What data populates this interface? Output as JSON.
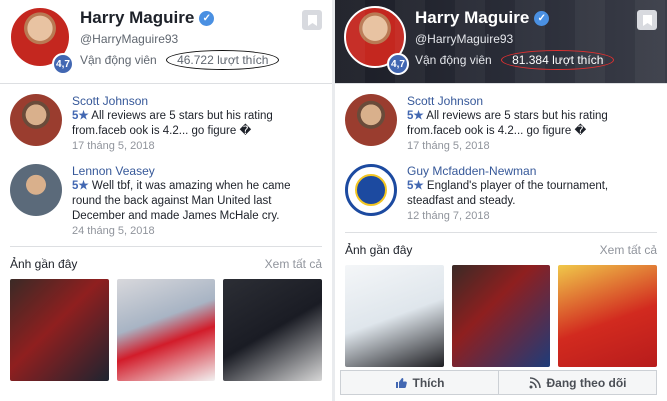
{
  "left": {
    "name": "Harry Maguire",
    "handle": "@HarryMaguire93",
    "category": "Vận động viên",
    "likes": "46.722 lượt thích",
    "rating": "4,7",
    "reviews": [
      {
        "author": "Scott Johnson",
        "stars": "5★",
        "text": "All reviews are 5 stars but his rating from.faceb ook is 4.2... go figure �",
        "date": "17 tháng 5, 2018"
      },
      {
        "author": "Lennon Veasey",
        "stars": "5★",
        "text": "Well tbf, it was amazing when he came round the back against Man United last December and made James McHale cry.",
        "date": "24 tháng 5, 2018"
      }
    ],
    "recent_photos_label": "Ảnh gần đây",
    "see_all_label": "Xem tất cả"
  },
  "right": {
    "name": "Harry Maguire",
    "handle": "@HarryMaguire93",
    "category": "Vận động viên",
    "likes": "81.384 lượt thích",
    "rating": "4,7",
    "reviews": [
      {
        "author": "Scott Johnson",
        "stars": "5★",
        "text": "All reviews are 5 stars but his rating from.faceb ook is 4.2... go figure �",
        "date": "17 tháng 5, 2018"
      },
      {
        "author": "Guy Mcfadden-Newman",
        "stars": "5★",
        "text": "England's player of the tournament, steadfast and steady.",
        "date": "12 tháng 7, 2018"
      }
    ],
    "recent_photos_label": "Ảnh gần đây",
    "see_all_label": "Xem tất cả",
    "like_button": "Thích",
    "follow_button": "Đang theo dõi"
  },
  "icons": {
    "verified": "verified-check-icon",
    "bookmark": "bookmark-icon",
    "like": "thumbs-up-icon",
    "follow": "rss-icon"
  },
  "colors": {
    "link": "#365899",
    "badge": "#4267b2",
    "highlight_left": "#111111",
    "highlight_right": "#e03030"
  }
}
